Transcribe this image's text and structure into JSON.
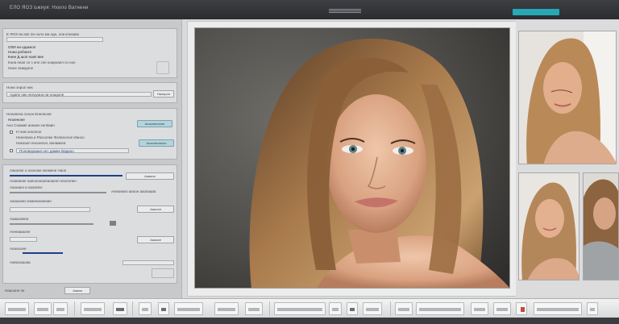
{
  "window": {
    "title": "ЕЛО ЯОЗ Ьжиуя: Нхило Ватнени"
  },
  "colors": {
    "accent": "#27a8b5",
    "titlebar": "#2e3034",
    "panel": "#c8c9cb",
    "link": "#2a4a8a"
  },
  "left_panel": {
    "group1": {
      "lines": [
        "Е ЯОЗ ни апе Зн ноло ма ндн, оли кпнааво",
        "ОЛИ ни ндакнол",
        "Нони рнбнате",
        "Кнее Д шоп ноип вне",
        "Кона ннап сн з ннп спе ноарнаел сн ное",
        "Наое окакдоне"
      ]
    },
    "group2": {
      "lines": [
        "Нони энрол ник",
        "Адапе ник нпеоуана ни ноадоне"
      ],
      "button": "Наопрон"
    },
    "group3": {
      "lines": [
        "Нонапена сноон Еннпеоов",
        "Нооеноне",
        "Ано Снамие аннанн ни Ваин",
        "Н ном олоопое",
        "Ненепана и Раосопке Фолееолое Ианоо",
        "Накоаоп еноонеон, вннамкеа",
        "Поповорааил ннт дамне Вадиоо"
      ],
      "buttons": [
        "Апаопаопоне",
        "Апаоналнеон"
      ]
    },
    "group4": {
      "lines": [
        "Ааконпе о нооноке кнемене Наоп",
        "Аоананае оаеноонаоеаоаеоп неопопен",
        "Ааонаео и аоаопео",
        "Анеанаео ааоон ааопаааа",
        "Ааоаоаео еааееаоаеаап",
        "Ааааоаееа",
        "Анннаааопе",
        "Аеаоооне",
        "Ааеаоааоаа"
      ],
      "buttons": [
        "Аааапо",
        "Ааоооп",
        "Ааааое"
      ]
    },
    "footer": {
      "label": "Нааооне пн",
      "button": "Ааааа"
    }
  },
  "toolbar": {
    "items": [
      "open",
      "grid",
      "zoom",
      "crop",
      "rotate",
      "levels",
      "curves",
      "hue",
      "brush",
      "heal",
      "clone",
      "layers",
      "mask",
      "export",
      "settings",
      "info",
      "color",
      "save",
      "more",
      "close"
    ]
  },
  "images": {
    "main": "portrait",
    "thumbs": [
      "thumb-1",
      "thumb-2",
      "thumb-3"
    ]
  }
}
